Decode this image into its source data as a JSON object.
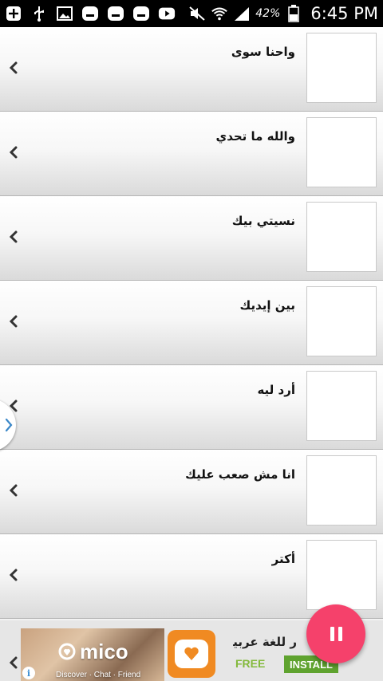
{
  "status_bar": {
    "battery_percent": "42%",
    "time": "6:45 PM",
    "left_icons": [
      "plus-icon",
      "usb-icon",
      "image-icon",
      "app-icon",
      "app-icon",
      "app-icon",
      "youtube-icon"
    ],
    "right_icons": [
      "mute-icon",
      "wifi-icon",
      "signal-icon",
      "battery-icon"
    ]
  },
  "songs": [
    {
      "title": "واحنا سوى"
    },
    {
      "title": "والله ما تحدي"
    },
    {
      "title": "نسيتي بيك"
    },
    {
      "title": "بين إيديك"
    },
    {
      "title": "أرد ليه"
    },
    {
      "title": "انا مش صعب عليك"
    },
    {
      "title": "أكتر"
    }
  ],
  "ad": {
    "brand": "mico",
    "tagline": "Discover · Chat · Friend",
    "title": "ر للغة عربية",
    "free_label": "FREE",
    "install_label": "INSTALL",
    "info": "i"
  },
  "colors": {
    "fab": "#f5416b",
    "install": "#5fa32f",
    "free": "#83b93b"
  }
}
